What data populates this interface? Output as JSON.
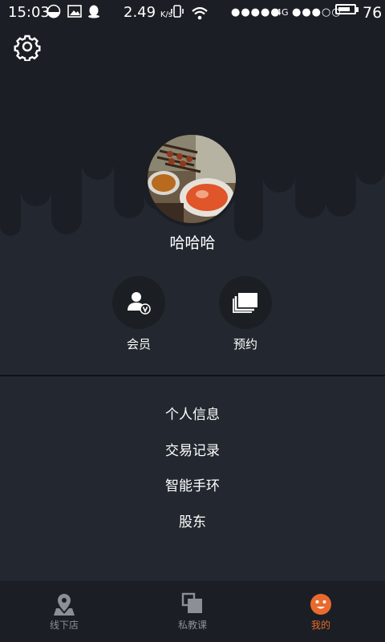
{
  "status_bar": {
    "time": "15:03",
    "speed_value": "2.49",
    "speed_unit": "K/s",
    "network": "4G",
    "battery_level": "76",
    "battery_fraction": 0.76
  },
  "profile": {
    "username": "哈哈哈"
  },
  "actions": {
    "member_label": "会员",
    "booking_label": "预约"
  },
  "menu": {
    "items": [
      {
        "label": "个人信息"
      },
      {
        "label": "交易记录"
      },
      {
        "label": "智能手环"
      },
      {
        "label": "股东"
      }
    ]
  },
  "bottom_nav": {
    "tabs": [
      {
        "label": "线下店",
        "icon": "map-pin-icon"
      },
      {
        "label": "私教课",
        "icon": "stacked-squares-icon"
      },
      {
        "label": "我的",
        "icon": "smiley-face-icon",
        "active": true
      }
    ]
  },
  "colors": {
    "background": "#232830",
    "header_shape": "#1b1f25",
    "accent": "#ea6a2e",
    "tab_inactive": "#8b8f96"
  }
}
